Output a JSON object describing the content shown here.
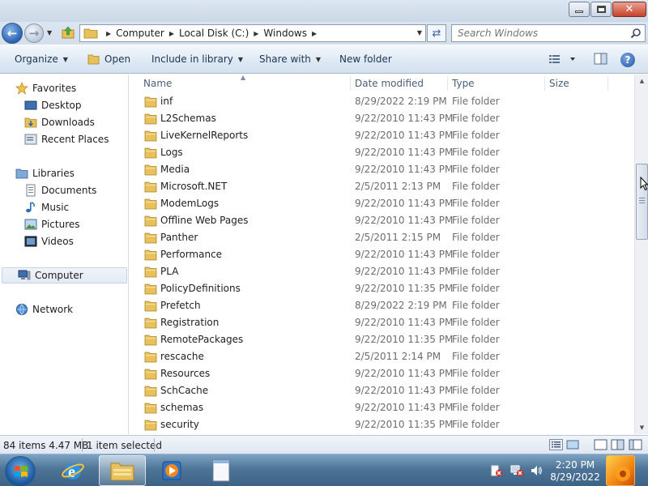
{
  "window": {
    "minimize_icon": "minimize-icon",
    "maximize_icon": "restore-icon",
    "close_glyph": "✕"
  },
  "address": {
    "crumbs": [
      "Computer",
      "Local Disk (C:)",
      "Windows"
    ],
    "search_placeholder": "Search Windows"
  },
  "toolbar": {
    "organize": "Organize",
    "open": "Open",
    "include": "Include in library",
    "share": "Share with",
    "new_folder": "New folder",
    "help": "?"
  },
  "nav": {
    "favorites": "Favorites",
    "desktop": "Desktop",
    "downloads": "Downloads",
    "recent": "Recent Places",
    "libraries": "Libraries",
    "documents": "Documents",
    "music": "Music",
    "pictures": "Pictures",
    "videos": "Videos",
    "computer": "Computer",
    "network": "Network"
  },
  "columns": {
    "name": "Name",
    "date": "Date modified",
    "type": "Type",
    "size": "Size"
  },
  "files": [
    {
      "name": "inf",
      "date": "8/29/2022 2:19 PM",
      "type": "File folder"
    },
    {
      "name": "L2Schemas",
      "date": "9/22/2010 11:43 PM",
      "type": "File folder"
    },
    {
      "name": "LiveKernelReports",
      "date": "9/22/2010 11:43 PM",
      "type": "File folder"
    },
    {
      "name": "Logs",
      "date": "9/22/2010 11:43 PM",
      "type": "File folder"
    },
    {
      "name": "Media",
      "date": "9/22/2010 11:43 PM",
      "type": "File folder"
    },
    {
      "name": "Microsoft.NET",
      "date": "2/5/2011 2:13 PM",
      "type": "File folder"
    },
    {
      "name": "ModemLogs",
      "date": "9/22/2010 11:43 PM",
      "type": "File folder"
    },
    {
      "name": "Offline Web Pages",
      "date": "9/22/2010 11:43 PM",
      "type": "File folder"
    },
    {
      "name": "Panther",
      "date": "2/5/2011 2:15 PM",
      "type": "File folder"
    },
    {
      "name": "Performance",
      "date": "9/22/2010 11:43 PM",
      "type": "File folder"
    },
    {
      "name": "PLA",
      "date": "9/22/2010 11:43 PM",
      "type": "File folder"
    },
    {
      "name": "PolicyDefinitions",
      "date": "9/22/2010 11:35 PM",
      "type": "File folder"
    },
    {
      "name": "Prefetch",
      "date": "8/29/2022 2:19 PM",
      "type": "File folder"
    },
    {
      "name": "Registration",
      "date": "9/22/2010 11:43 PM",
      "type": "File folder"
    },
    {
      "name": "RemotePackages",
      "date": "9/22/2010 11:35 PM",
      "type": "File folder"
    },
    {
      "name": "rescache",
      "date": "2/5/2011 2:14 PM",
      "type": "File folder"
    },
    {
      "name": "Resources",
      "date": "9/22/2010 11:43 PM",
      "type": "File folder"
    },
    {
      "name": "SchCache",
      "date": "9/22/2010 11:43 PM",
      "type": "File folder"
    },
    {
      "name": "schemas",
      "date": "9/22/2010 11:43 PM",
      "type": "File folder"
    },
    {
      "name": "security",
      "date": "9/22/2010 11:35 PM",
      "type": "File folder"
    }
  ],
  "status": {
    "items": "84 items  4.47 MB",
    "selected": "1 item selected"
  },
  "taskbar": {
    "time": "2:20 PM",
    "date": "8/29/2022",
    "apps": [
      "internet-explorer-icon",
      "windows-explorer-icon",
      "media-player-icon",
      "notepad-icon"
    ]
  },
  "colors": {
    "folder": "#e8c15a",
    "accent": "#1e3452",
    "close": "#c7422a"
  }
}
